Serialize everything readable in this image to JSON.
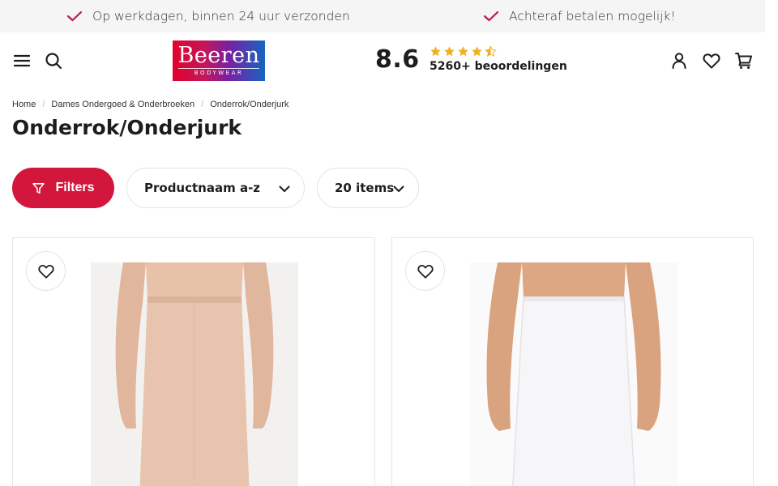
{
  "usp": [
    {
      "text": "Op werkdagen, binnen 24 uur verzonden"
    },
    {
      "text": "Achteraf betalen mogelijk!"
    }
  ],
  "logo": {
    "main": "Beeren",
    "sub": "BODYWEAR"
  },
  "rating": {
    "score": "8.6",
    "stars": 4.5,
    "count": "5260+ beoordelingen"
  },
  "breadcrumb": [
    "Home",
    "Dames Ondergoed & Onderbroeken",
    "Onderrok/Onderjurk"
  ],
  "page": {
    "title": "Onderrok/Onderjurk"
  },
  "toolbar": {
    "filters_label": "Filters",
    "sort_value": "Productnaam a-z",
    "count_value": "20 items"
  },
  "icons": {
    "menu": "menu-icon",
    "search": "search-icon",
    "user": "user-icon",
    "wishlist": "heart-icon",
    "cart": "cart-icon",
    "filter": "filter-icon",
    "chevron": "chevron-down-icon",
    "check": "check-icon",
    "star": "star-icon"
  },
  "colors": {
    "accent": "#d3173c",
    "check": "#c0174a",
    "star": "#f2b01e",
    "usp_bg": "#f5f5f5",
    "text": "#1d1d1b"
  },
  "products": [
    {
      "color_name": "beige",
      "color": "#e8c4ae"
    },
    {
      "color_name": "white",
      "color": "#f6f6f8"
    }
  ]
}
